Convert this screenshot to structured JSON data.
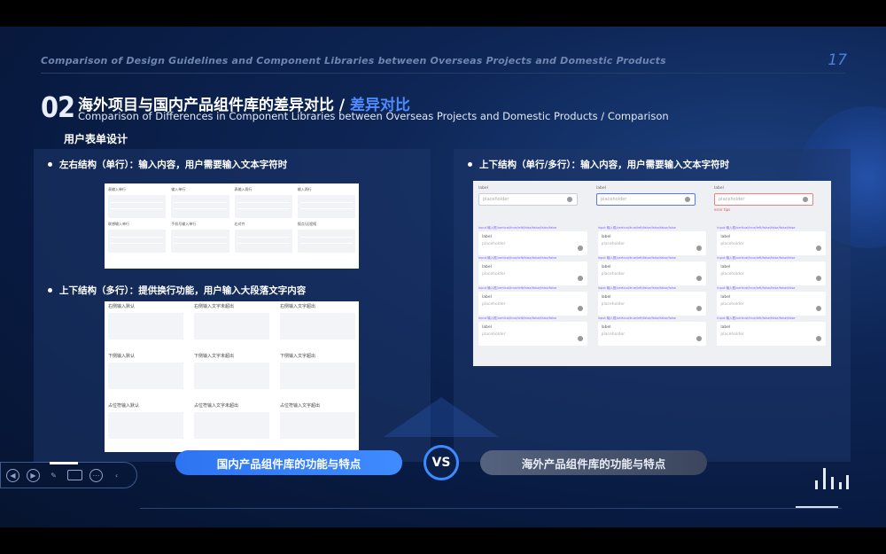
{
  "header": {
    "top_title": "Comparison of Design Guidelines and Component Libraries between Overseas Projects and Domestic Products",
    "page_number": "17"
  },
  "section": {
    "number": "02",
    "title_main": "海外项目与国内产品组件库的差异对比 / ",
    "title_accent": "差异对比",
    "subtitle": "Comparison of Differences in Component Libraries between Overseas Projects and Domestic Products / Comparison",
    "label": "用户表单设计"
  },
  "left_panel": {
    "bullet1": "左右结构（单行）：输入内容，用户需要输入文本字符时",
    "bullet2": "上下结构（多行）：提供换行功能，用户输入大段落文字内容",
    "shot1_headers": [
      "表输入单行",
      "输入单行",
      "表输入两行",
      "输入两行",
      "联想输入单行",
      "手机号输入单行",
      "右对齐",
      "搜点/远程搜"
    ],
    "shot2_headers": [
      "右侧输入默认",
      "右侧输入文字未超出",
      "右侧输入文字超出",
      "下侧输入默认",
      "下侧输入文字未超出",
      "下侧输入文字超出",
      "占位符输入默认",
      "占位符输入文字未超出",
      "占位符输入文字超出"
    ]
  },
  "right_panel": {
    "bullet1": "上下结构（单行/多行）：输入内容，用户需要输入文本字符时",
    "field_label": "label",
    "placeholder": "placeholder",
    "error_text": "error tips",
    "tips": "tips content",
    "row_tag": "Input 输入框/vertical/true/left/false/false/false/false"
  },
  "compare": {
    "left_label": "国内产品组件库的功能与特点",
    "vs": "VS",
    "right_label": "海外产品组件库的功能与特点"
  },
  "toolbar": {
    "icons": [
      "prev-icon",
      "play-icon",
      "pen-icon",
      "screen-icon",
      "more-icon",
      "collapse-icon"
    ]
  }
}
